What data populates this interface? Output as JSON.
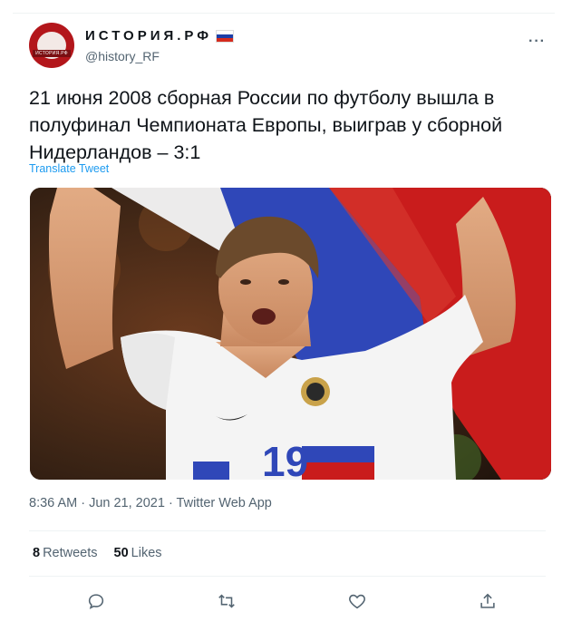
{
  "tweet": {
    "display_name": "ИСТОРИЯ.РФ",
    "handle": "@history_RF",
    "avatar_text": "ИСТОРИЯ.РФ",
    "more_label": "···",
    "text": "21 июня 2008 сборная России по футболу вышла в полуфинал Чемпионата Европы, выиграв у сборной Нидерландов – 3:1",
    "translate_label": "Translate Tweet",
    "media": {
      "jersey_number": "19",
      "alt": "Football player in white jersey number 19 celebrating with the Russian flag"
    },
    "timestamp": "8:36 AM · Jun 21, 2021 · Twitter Web App",
    "stats": {
      "retweets_count": "8",
      "retweets_label": "Retweets",
      "likes_count": "50",
      "likes_label": "Likes"
    },
    "actions": [
      "reply-icon",
      "retweet-icon",
      "like-icon",
      "share-icon"
    ]
  },
  "colors": {
    "text": "#0f1419",
    "secondary": "#536471",
    "link": "#1d9bf0",
    "avatar_bg": "#b3161b",
    "flag_white": "#ffffff",
    "flag_blue": "#1c3fa8",
    "flag_red": "#d52b1e"
  }
}
